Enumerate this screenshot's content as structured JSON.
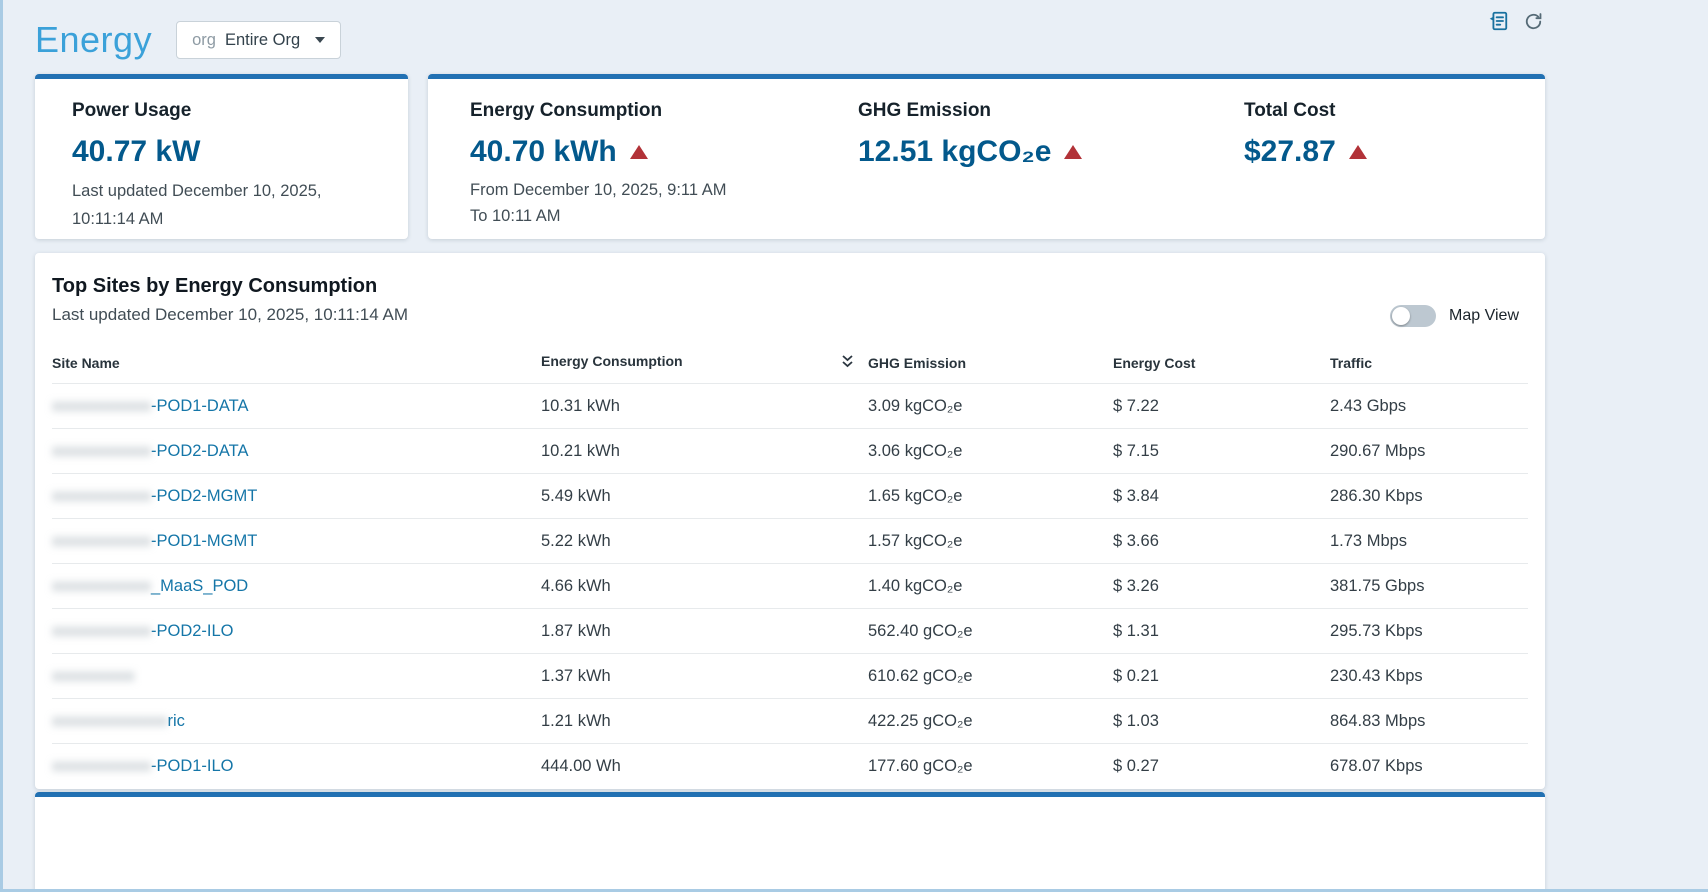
{
  "header": {
    "title": "Energy",
    "scope_label": "org",
    "scope_value": "Entire Org"
  },
  "summary": {
    "power_usage": {
      "title": "Power Usage",
      "value": "40.77 kW",
      "updated_line": "Last updated December 10, 2025, 10:11:14 AM"
    },
    "energy_consumption": {
      "title": "Energy Consumption",
      "value": "40.70 kWh",
      "trend": "up",
      "from_line": "From December 10, 2025, 9:11 AM",
      "to_line": "To 10:11 AM"
    },
    "ghg_emission": {
      "title": "GHG Emission",
      "value": "12.51 kgCO₂e",
      "trend": "up"
    },
    "total_cost": {
      "title": "Total Cost",
      "value": "$27.87",
      "trend": "up"
    }
  },
  "top_sites": {
    "title": "Top Sites by Energy Consumption",
    "updated_line": "Last updated December 10, 2025, 10:11:14 AM",
    "map_view_label": "Map View",
    "map_view_enabled": false,
    "sort": {
      "column": "Energy Consumption",
      "direction": "descending"
    },
    "columns": [
      "Site Name",
      "Energy Consumption",
      "GHG Emission",
      "Energy Cost",
      "Traffic"
    ],
    "rows": [
      {
        "site_redacted": "xxxxxxxxxxxx",
        "site_suffix": "-POD1-DATA",
        "energy_consumption": "10.31 kWh",
        "ghg_emission": "3.09 kgCO₂e",
        "energy_cost": "$ 7.22",
        "traffic": "2.43 Gbps"
      },
      {
        "site_redacted": "xxxxxxxxxxxx",
        "site_suffix": "-POD2-DATA",
        "energy_consumption": "10.21 kWh",
        "ghg_emission": "3.06 kgCO₂e",
        "energy_cost": "$ 7.15",
        "traffic": "290.67 Mbps"
      },
      {
        "site_redacted": "xxxxxxxxxxxx",
        "site_suffix": "-POD2-MGMT",
        "energy_consumption": "5.49 kWh",
        "ghg_emission": "1.65 kgCO₂e",
        "energy_cost": "$ 3.84",
        "traffic": "286.30 Kbps"
      },
      {
        "site_redacted": "xxxxxxxxxxxx",
        "site_suffix": "-POD1-MGMT",
        "energy_consumption": "5.22 kWh",
        "ghg_emission": "1.57 kgCO₂e",
        "energy_cost": "$ 3.66",
        "traffic": "1.73 Mbps"
      },
      {
        "site_redacted": "xxxxxxxxxxxx",
        "site_suffix": "_MaaS_POD",
        "energy_consumption": "4.66 kWh",
        "ghg_emission": "1.40 kgCO₂e",
        "energy_cost": "$ 3.26",
        "traffic": "381.75 Gbps"
      },
      {
        "site_redacted": "xxxxxxxxxxxx",
        "site_suffix": "-POD2-ILO",
        "energy_consumption": "1.87 kWh",
        "ghg_emission": "562.40 gCO₂e",
        "energy_cost": "$ 1.31",
        "traffic": "295.73 Kbps"
      },
      {
        "site_redacted": "xxxxxxxxxx",
        "site_suffix": "",
        "energy_consumption": "1.37 kWh",
        "ghg_emission": "610.62 gCO₂e",
        "energy_cost": "$ 0.21",
        "traffic": "230.43 Kbps"
      },
      {
        "site_redacted": "xxxxxxxxxxxxxx",
        "site_suffix": "ric",
        "energy_consumption": "1.21 kWh",
        "ghg_emission": "422.25 gCO₂e",
        "energy_cost": "$ 1.03",
        "traffic": "864.83 Mbps"
      },
      {
        "site_redacted": "xxxxxxxxxxxx",
        "site_suffix": "-POD1-ILO",
        "energy_consumption": "444.00 Wh",
        "ghg_emission": "177.60 gCO₂e",
        "energy_cost": "$ 0.27",
        "traffic": "678.07 Kbps"
      }
    ]
  },
  "colors": {
    "accent_blue": "#2271b3",
    "title_blue": "#3ba1d9",
    "value_blue": "#03598c",
    "trend_red": "#b23238",
    "link_blue": "#1576a8"
  }
}
